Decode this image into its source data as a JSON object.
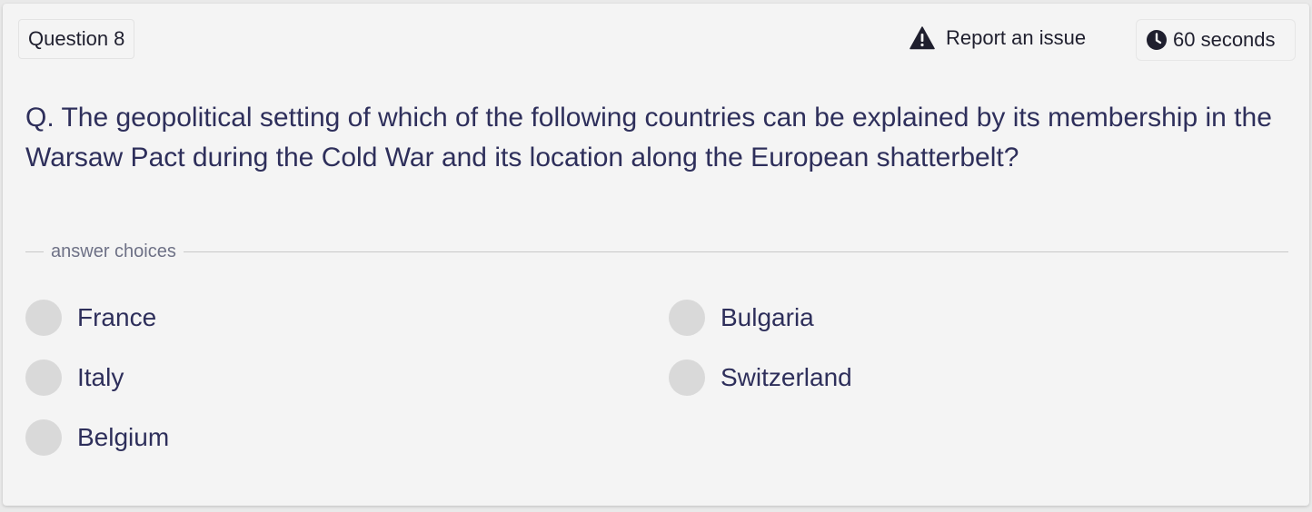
{
  "header": {
    "question_number": "Question 8",
    "report_label": "Report an issue",
    "report_icon": "warning-triangle-icon",
    "timer_label": "60 seconds",
    "timer_icon": "clock-icon"
  },
  "question": {
    "text": "Q. The geopolitical setting of which of the following countries can be explained by its membership in the Warsaw Pact during the Cold War and its location along the European shatterbelt?"
  },
  "divider": {
    "label": "answer choices"
  },
  "choices": [
    {
      "label": "France"
    },
    {
      "label": "Bulgaria"
    },
    {
      "label": "Italy"
    },
    {
      "label": "Switzerland"
    },
    {
      "label": "Belgium"
    }
  ],
  "colors": {
    "question_text": "#2e2f5b",
    "radio_fill": "#d9d9d9",
    "card_background": "#f4f4f4"
  }
}
